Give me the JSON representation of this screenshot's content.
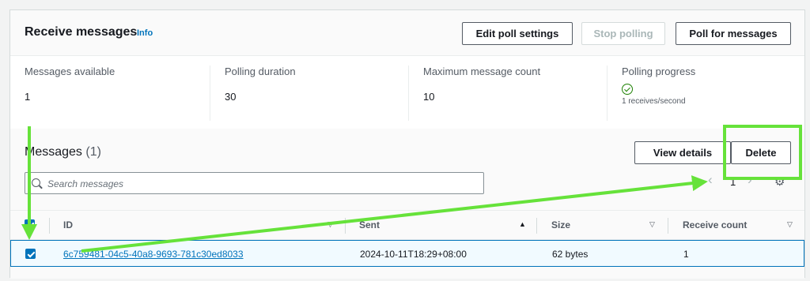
{
  "header": {
    "title": "Receive messages",
    "info_link": "Info",
    "edit_button": "Edit poll settings",
    "stop_button": "Stop polling",
    "poll_button": "Poll for messages"
  },
  "stats": {
    "available_label": "Messages available",
    "available_value": "1",
    "duration_label": "Polling duration",
    "duration_value": "30",
    "max_count_label": "Maximum message count",
    "max_count_value": "10",
    "progress_label": "Polling progress",
    "progress_rate": "1 receives/second"
  },
  "messages": {
    "title": "Messages",
    "count": "(1)",
    "view_button": "View details",
    "delete_button": "Delete",
    "search_placeholder": "Search messages",
    "page_number": "1",
    "columns": [
      "ID",
      "Sent",
      "Size",
      "Receive count"
    ],
    "rows": [
      {
        "id": "6c759481-04c5-40a8-9693-781c30ed8033",
        "sent": "2024-10-11T18:29+08:00",
        "size": "62 bytes",
        "receive_count": "1"
      }
    ]
  },
  "colors": {
    "accent": "#0073bb",
    "success": "#1d8102",
    "annotation": "#66e23a"
  },
  "icons": {
    "search": "search-icon",
    "prev": "chevron-left-icon",
    "next": "chevron-right-icon",
    "settings": "gear-icon",
    "progress": "check-circle-icon"
  }
}
